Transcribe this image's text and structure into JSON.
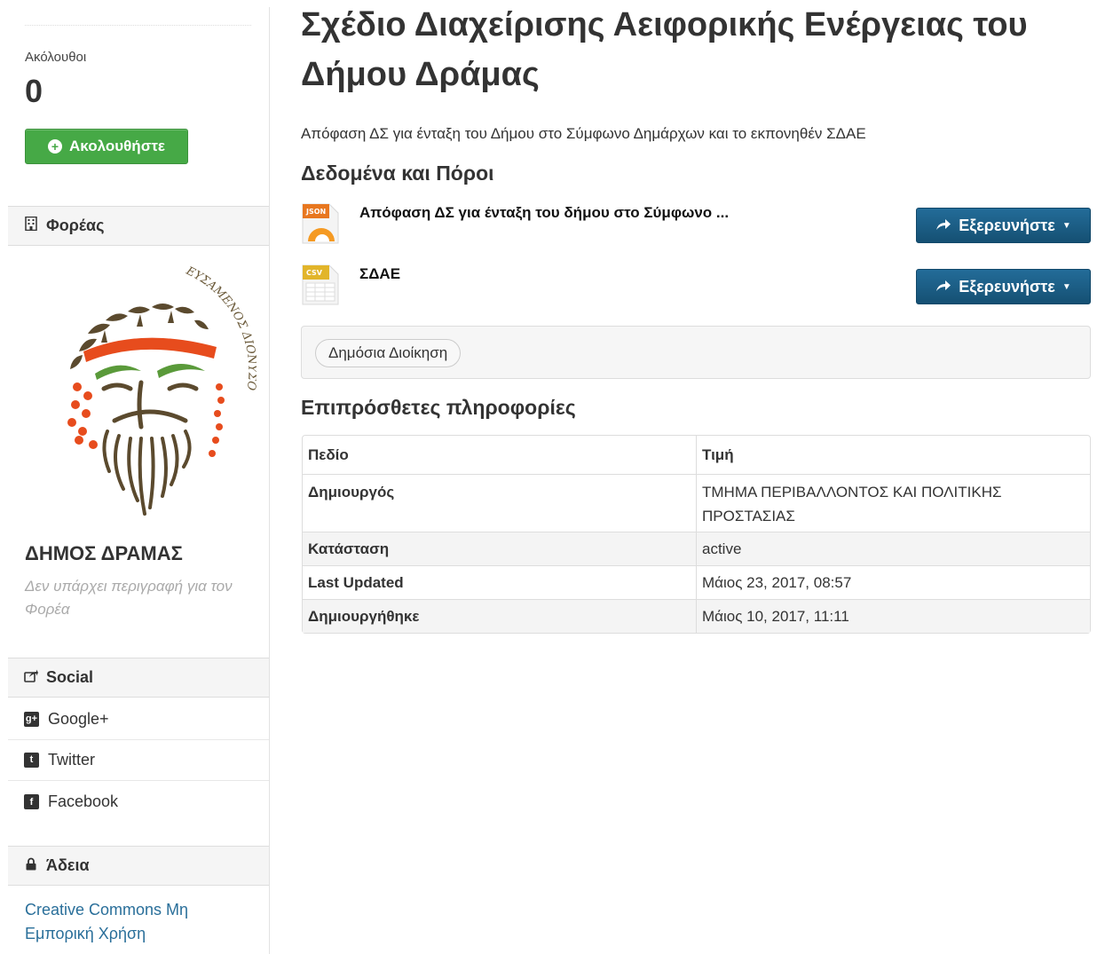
{
  "sidebar": {
    "followers_label": "Ακόλουθοι",
    "followers_count": "0",
    "follow_button": "Ακολουθήστε",
    "org_section_title": "Φορέας",
    "org_name": "ΔΗΜΟΣ ΔΡΑΜΑΣ",
    "org_description": "Δεν υπάρχει περιγραφή για τον Φορέα",
    "logo_text": "ΕΥΣΑΜΕΝΟΣ ΔΙΟΝΥΣΟΙ",
    "social_title": "Social",
    "social_items": [
      {
        "label": "Google+",
        "icon": "google-plus-icon"
      },
      {
        "label": "Twitter",
        "icon": "twitter-icon"
      },
      {
        "label": "Facebook",
        "icon": "facebook-icon"
      }
    ],
    "license_title": "Άδεια",
    "license_link": "Creative Commons Μη Εμπορική Χρήση"
  },
  "main": {
    "title": "Σχέδιο Διαχείρισης Αειφορικής Ενέργειας του Δήμου Δράμας",
    "notes": "Απόφαση ΔΣ για ένταξη του Δήμου στο Σύμφωνο Δημάρχων και το εκπονηθέν ΣΔΑΕ",
    "resources_heading": "Δεδομένα και Πόροι",
    "resources": [
      {
        "name": "Απόφαση ΔΣ για ένταξη του δήμου στο Σύμφωνο ...",
        "format": "JSON",
        "button": "Εξερευνήστε"
      },
      {
        "name": "ΣΔΑΕ",
        "format": "CSV",
        "button": "Εξερευνήστε"
      }
    ],
    "tags": [
      "Δημόσια Διοίκηση"
    ],
    "additional_heading": "Επιπρόσθετες πληροφορίες",
    "table": {
      "headers": [
        "Πεδίο",
        "Τιμή"
      ],
      "rows": [
        {
          "field": "Δημιουργός",
          "value": "ΤΜΗΜΑ ΠΕΡΙΒΑΛΛΟΝΤΟΣ ΚΑΙ ΠΟΛΙΤΙΚΗΣ ΠΡΟΣΤΑΣΙΑΣ"
        },
        {
          "field": "Κατάσταση",
          "value": "active"
        },
        {
          "field": "Last Updated",
          "value": "Μάιος 23, 2017, 08:57"
        },
        {
          "field": "Δημιουργήθηκε",
          "value": "Μάιος 10, 2017, 11:11"
        }
      ]
    }
  },
  "colors": {
    "follow_green": "#46a946",
    "explore_blue": "#1a5f8a",
    "link_blue": "#2a6f9a"
  }
}
